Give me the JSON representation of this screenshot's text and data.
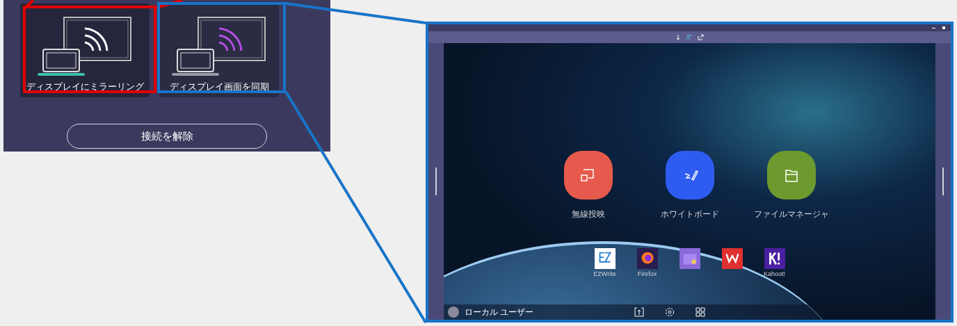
{
  "panel": {
    "modes": [
      {
        "label": "ディスプレイにミラーリング",
        "selected": true
      },
      {
        "label": "ディスプレイ画面を同期",
        "selected": false
      }
    ],
    "disconnect_button": "接続を解除"
  },
  "display": {
    "apps": [
      {
        "kind": "cast",
        "label": "無線投映",
        "color": "#e55a4c"
      },
      {
        "kind": "pen",
        "label": "ホワイトボード",
        "color": "#2f5cf0"
      },
      {
        "kind": "folder",
        "label": "ファイルマネージャ",
        "color": "#6c9a2e"
      }
    ],
    "dock": [
      {
        "kind": "ezwrite",
        "label": "EZWrite"
      },
      {
        "kind": "firefox",
        "label": "Firefox"
      },
      {
        "kind": "store"
      },
      {
        "kind": "wps"
      },
      {
        "kind": "kahoot",
        "label": "Kahoot!"
      }
    ],
    "user": "ローカル ユーザー"
  }
}
